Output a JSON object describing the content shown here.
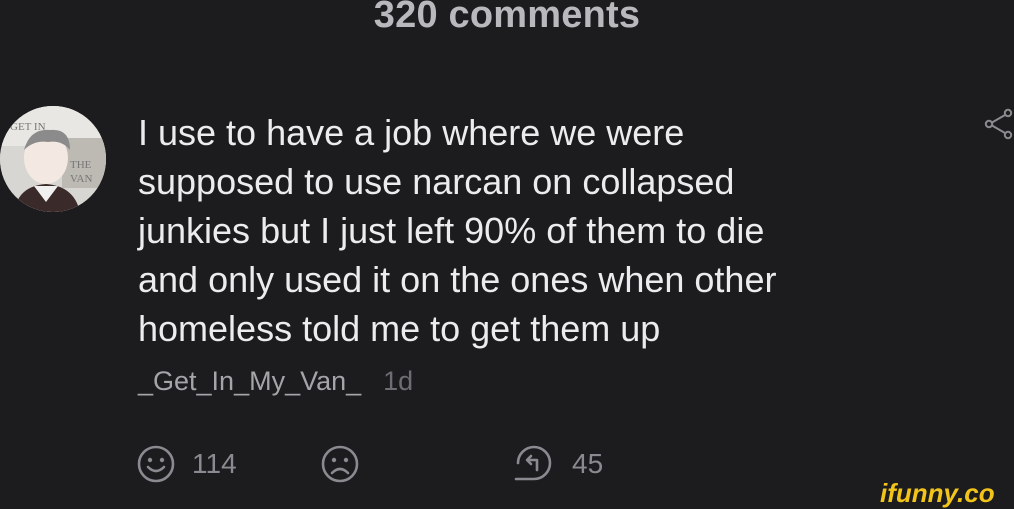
{
  "header": {
    "title": "320 comments"
  },
  "comment": {
    "text": "I use to have a job where we were\nsupposed to use narcan on collapsed\njunkies but I just left 90% of them to die\nand only used it on the ones when other\nhomeless told me to get them up",
    "username": "_Get_In_My_Van_",
    "time": "1d",
    "avatar_text": [
      "GET IN",
      "THE",
      "VAN"
    ]
  },
  "actions": {
    "smile_count": "114",
    "reply_count": "45"
  },
  "icons": {
    "share": "share-icon",
    "smile": "smile-icon",
    "unsmile": "unsmile-icon",
    "reply": "reply-icon"
  },
  "watermark": "ifunny.co",
  "colors": {
    "background": "#1c1c1f",
    "title": "#b9b9bd",
    "text": "#ececee",
    "muted": "#8a8a90",
    "watermark": "#f2c41a"
  }
}
